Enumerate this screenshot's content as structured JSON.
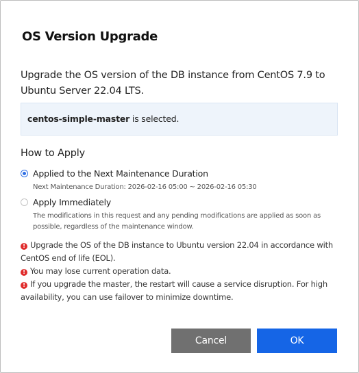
{
  "dialog": {
    "title": "OS Version Upgrade",
    "description": "Upgrade the OS version of the DB instance from CentOS 7.9 to Ubuntu Server 22.04 LTS.",
    "selection": {
      "instance_name": "centos-simple-master",
      "suffix": " is selected."
    },
    "how_to_apply": {
      "label": "How to Apply",
      "options": [
        {
          "label": "Applied to the Next Maintenance Duration",
          "sub": "Next Maintenance Duration: 2026-02-16 05:00 ~ 2026-02-16 05:30",
          "checked": true
        },
        {
          "label": "Apply Immediately",
          "sub": "The modifications in this request and any pending modifications are applied as soon as possible, regardless of the maintenance window.",
          "checked": false
        }
      ]
    },
    "warnings": [
      "Upgrade the OS of the DB instance to Ubuntu version 22.04 in accordance with CentOS end of life (EOL).",
      "You may lose current operation data.",
      "If you upgrade the master, the restart will cause a service disruption. For high availability, you can use failover to minimize downtime."
    ],
    "buttons": {
      "cancel": "Cancel",
      "ok": "OK"
    }
  },
  "colors": {
    "primary": "#1565e6",
    "cancel": "#707070",
    "warning": "#e02c2c",
    "info_bg": "#eef4fb"
  },
  "icons": {
    "warning": "exclamation-circle"
  }
}
